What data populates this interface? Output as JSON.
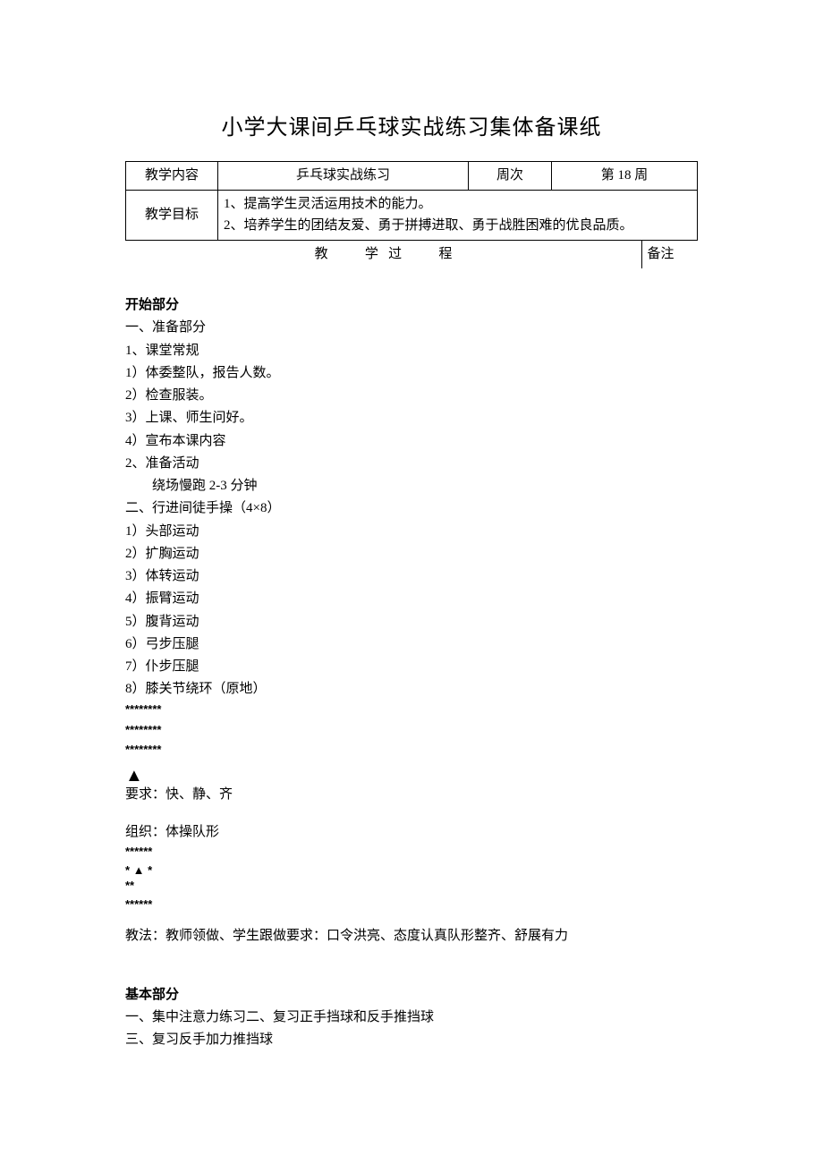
{
  "title": "小学大课间乒乓球实战练习集体备课纸",
  "table": {
    "row1": {
      "label_content": "教学内容",
      "content": "乒乓球实战练习",
      "label_week": "周次",
      "week": "第 18 周"
    },
    "row2": {
      "label": "教学目标",
      "line1": "1、提高学生灵活运用技术的能力。",
      "line2": "2、培养学生的团结友爱、勇于拼搏进取、勇于战胜困难的优良品质。"
    },
    "row3": {
      "process_jiao": "教",
      "process_xue": "学",
      "process_guo": "过",
      "process_cheng": "程",
      "remark": "备注"
    }
  },
  "start": {
    "heading": "开始部分",
    "s1": "一、准备部分",
    "s1_1": "1、课堂常规",
    "s1_1_1": "1）体委整队，报告人数。",
    "s1_1_2": "2）检查服装。",
    "s1_1_3": "3）上课、师生问好。",
    "s1_1_4": "4）宣布本课内容",
    "s1_2": "2、准备活动",
    "s1_2_1": "绕场慢跑 2-3 分钟",
    "s2": "二、行进间徒手操（4×8）",
    "s2_1": "1）头部运动",
    "s2_2": "2）扩胸运动",
    "s2_3": "3）体转运动",
    "s2_4": "4）振臂运动",
    "s2_5": "5）腹背运动",
    "s2_6": "6）弓步压腿",
    "s2_7": "7）仆步压腿",
    "s2_8": "8）膝关节绕环（原地）",
    "stars1_l1": "********",
    "stars1_l2": "********",
    "stars1_l3": "********",
    "triangle": "▲",
    "req1": "要求：快、静、齐",
    "org": "组织：体操队形",
    "stars2_l1": "******",
    "stars2_l2": "* ▲ *",
    "stars2_l3": "**",
    "stars2_l4": "******",
    "method": "教法：教师领做、学生跟做要求：口令洪亮、态度认真队形整齐、舒展有力"
  },
  "basic": {
    "heading": "基本部分",
    "b1": "一、集中注意力练习二、复习正手挡球和反手推挡球",
    "b3": "三、复习反手加力推挡球"
  }
}
